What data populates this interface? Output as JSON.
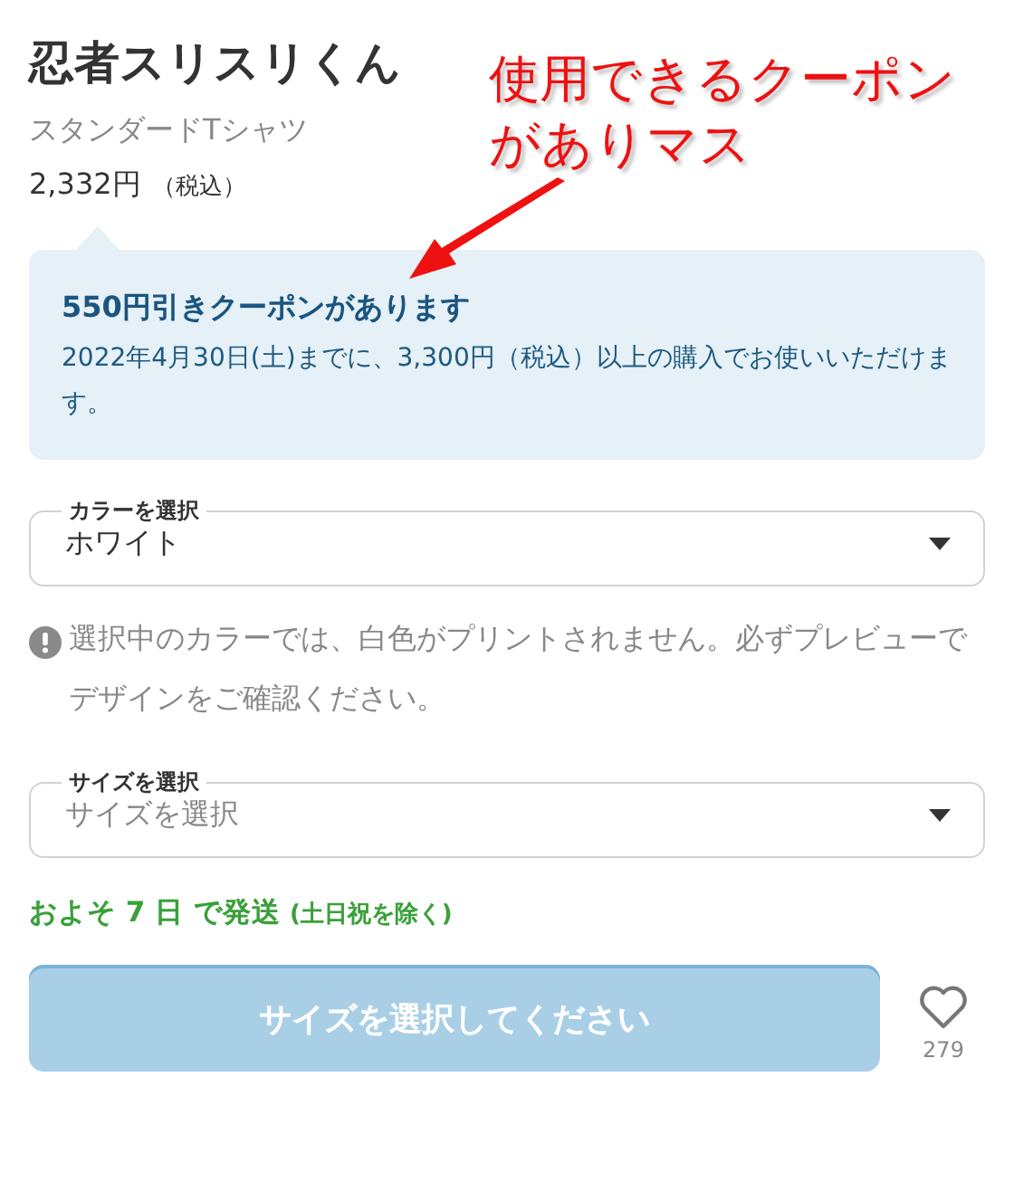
{
  "product": {
    "title": "忍者スリスリくん",
    "subtitle": "スタンダードTシャツ",
    "price": "2,332円",
    "tax_note": "（税込）"
  },
  "coupon": {
    "title": "550円引きクーポンがあります",
    "description": "2022年4月30日(土)までに、3,300円（税込）以上の購入でお使いいただけます。"
  },
  "selects": [
    {
      "label": "カラーを選択",
      "value": "ホワイト"
    },
    {
      "label": "サイズを選択",
      "placeholder": "サイズを選択"
    }
  ],
  "warning": "選択中のカラーでは、白色がプリントされません。必ずプレビューでデザインをご確認ください。",
  "shipping": {
    "lead": "およそ 7 日 で発送",
    "note": "(土日祝を除く)"
  },
  "cart_button": {
    "label": "サイズを選択してください",
    "disabled": true
  },
  "favorite": {
    "count": "279",
    "on": false
  },
  "annotation": {
    "text": "使用できるクーポンがありマス"
  }
}
